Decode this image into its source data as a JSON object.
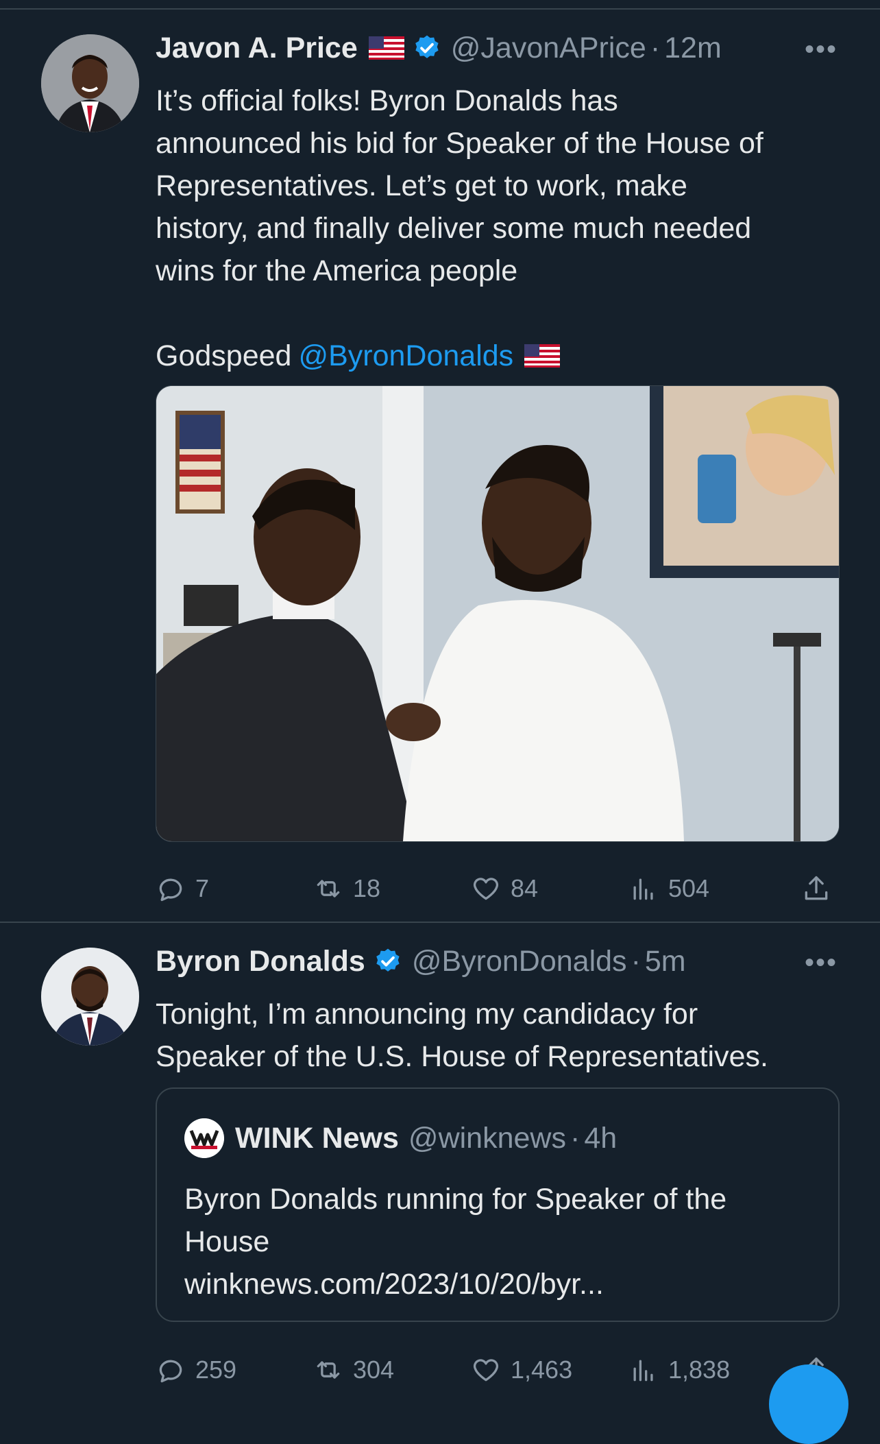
{
  "tweets": [
    {
      "name": "Javon A. Price",
      "handle": "@JavonAPrice",
      "dot": "·",
      "time": "12m",
      "text_lines": [
        "It’s official folks! Byron Donalds has",
        "announced his bid for Speaker of the House of",
        "Representatives. Let’s get to work, make",
        "history, and finally deliver some much needed",
        "wins for the America people"
      ],
      "godspeed": "Godspeed",
      "mention": "@ByronDonalds",
      "replies": "7",
      "reposts": "18",
      "likes": "84",
      "views": "504"
    },
    {
      "name": "Byron Donalds",
      "handle": "@ByronDonalds",
      "dot": "·",
      "time": "5m",
      "text_lines": [
        "Tonight, I’m announcing my candidacy for",
        "Speaker of the U.S. House of Representatives."
      ],
      "quote": {
        "name": "WINK News",
        "handle": "@winknews",
        "dot": "·",
        "time": "4h",
        "text_lines": [
          "Byron Donalds running for Speaker of the",
          "House",
          "winknews.com/2023/10/20/byr..."
        ]
      },
      "replies": "259",
      "reposts": "304",
      "likes": "1,463",
      "views": "1,838"
    }
  ],
  "more_label": "•••",
  "colors": {
    "background": "#15202b",
    "text": "#e7e9ea",
    "muted": "#8b98a5",
    "accent": "#1d9bf0",
    "border": "#38444d"
  },
  "icons": [
    "verified-badge-icon",
    "us-flag-icon",
    "more-icon",
    "reply-icon",
    "repost-icon",
    "like-icon",
    "views-icon",
    "share-icon"
  ]
}
